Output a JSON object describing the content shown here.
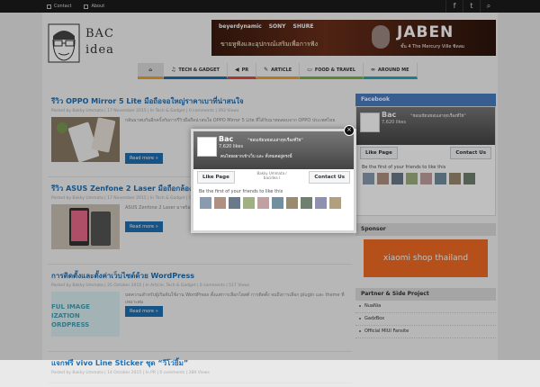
{
  "top_nav": {
    "contact": "Contact",
    "about": "About"
  },
  "social": {
    "facebook": "f",
    "twitter": "t",
    "search": "⌕"
  },
  "logo": {
    "line1": "BAC",
    "line2": "idea"
  },
  "banner": {
    "brands": [
      "beyerdynamic",
      "SONY",
      "SHURE"
    ],
    "tagline": "ขายหูฟังและอุปกรณ์เสริมเพื่อการฟัง",
    "brand_name": "JABEN",
    "location": "ชั้น 4 The Mercury Ville ชิดลม"
  },
  "nav": {
    "items": [
      {
        "label": "TECH & GADGET",
        "color": "#1e6fb4"
      },
      {
        "label": "PR",
        "color": "#e04a3f"
      },
      {
        "label": "ARTICLE",
        "color": "#f0a12a"
      },
      {
        "label": "FOOD & TRAVEL",
        "color": "#7cb342"
      },
      {
        "label": "AROUND ME",
        "color": "#29a8b4"
      }
    ]
  },
  "posts": [
    {
      "title": "รีวิว OPPO Mirror 5 Lite มือถือจอใหญ่ราคาเบาที่น่าสนใจ",
      "meta": "Posted by Bakky Ummata  |  17 November 2015  |  In  Tech & Gadget  |  0 comments  |  393 Views",
      "excerpt": "กลับมาพบกันอีกครั้งกับการรีวิวมือถือน่าสนใจ OPPO Mirror 5 Lite ที่ได้รับมาทดสอบจาก OPPO ประเทศไทย",
      "read_more": "Read more »"
    },
    {
      "title": "รีวิว ASUS Zenfone 2 Laser มือถือกล้องโฟกัสด้วยเลเซอร์",
      "meta": "Posted by Bakky Ummata  |  17 November 2015  |  In  Tech & Gadget  |  0 comments  |  Views",
      "excerpt": "ASUS Zenfone 2 Laser มาพร้อมระบบโฟกัสด้วย Laser ที่เร็วและแม่นยำ",
      "read_more": "Read more »"
    },
    {
      "title": "การติดตั้งและตั้งค่าเว็บไซต์ด้วย WordPress",
      "meta": "Posted by Bakky Ummata  |  25 October 2015  |  In  Article, Tech & Gadget  |  0 comments  |  517 Views",
      "excerpt": "บทความสำหรับผู้เริ่มต้นใช้งาน WordPress ตั้งแต่การเลือกโฮสต์ การติดตั้ง จนถึงการเลือก plugin และ theme ที่เหมาะสม",
      "read_more": "Read more »",
      "thumb_text": [
        "FUL IMAGE",
        "IZATION",
        "ORDPRESS"
      ]
    },
    {
      "title": "แจกฟรี vivo Line Sticker ชุด “วีโว่ยิ้ม”",
      "meta": "Posted by Bakky Ummata  |  14 October 2015  |  In  PR  |  0 comments  |  280 Views"
    }
  ],
  "sidebar": {
    "facebook_title": "Facebook",
    "sponsor_title": "Sponsor",
    "sponsor_text": "xiaomi shop thailand",
    "partner_title": "Partner & Side Project",
    "partners": [
      "NuaNia",
      "GadzBox",
      "Official MIUI Fansite"
    ]
  },
  "fb_popup": {
    "page_name": "Bac",
    "likes": "7,620 likes",
    "quote": "“ชอบเขียนชอบเล่าทุกเรื่องที่ใช่”",
    "sub": "คนไทยอยากเข้าเว็บ และ ทั้งหมดอยู่ตรงนี้",
    "like_button": "Like Page",
    "contact_button": "Contact Us",
    "mid_text": "Bakky Ummata\n/ bacidea /",
    "friends_label": "Be the first of your friends to like this",
    "close": "×"
  },
  "colors": {
    "accent_blue": "#1e6fb4",
    "xiaomi_orange": "#f26b25"
  }
}
